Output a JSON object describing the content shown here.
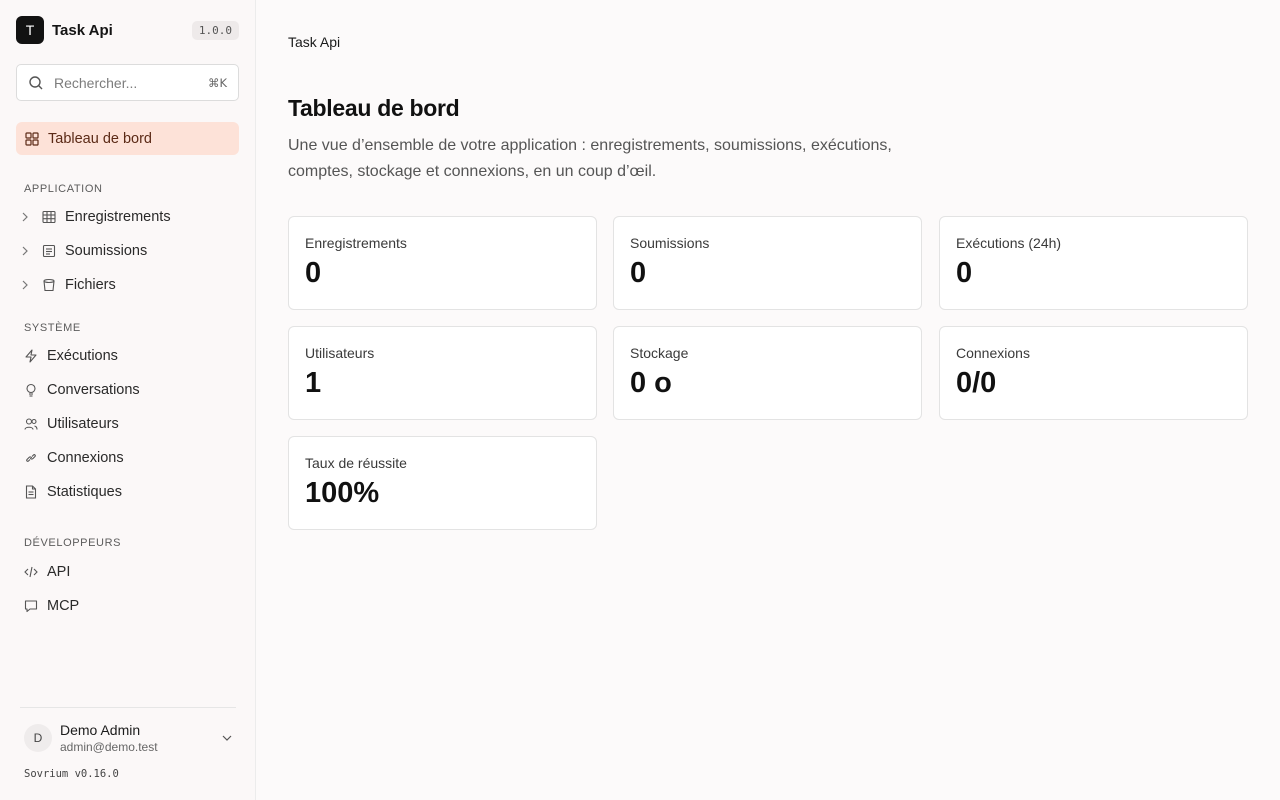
{
  "app": {
    "name": "Task Api",
    "logo_letter": "T",
    "version": "1.0.0"
  },
  "search": {
    "placeholder": "Rechercher...",
    "shortcut": "⌘K"
  },
  "sidebar": {
    "active_item": {
      "label": "Tableau de bord",
      "icon": "dashboard-grid-icon"
    },
    "sections": [
      {
        "title": "APPLICATION",
        "items": [
          {
            "label": "Enregistrements",
            "icon": "table-icon",
            "expandable": true
          },
          {
            "label": "Soumissions",
            "icon": "form-icon",
            "expandable": true
          },
          {
            "label": "Fichiers",
            "icon": "bucket-icon",
            "expandable": true
          }
        ]
      },
      {
        "title": "SYSTÈME",
        "items": [
          {
            "label": "Exécutions",
            "icon": "lightning-icon"
          },
          {
            "label": "Conversations",
            "icon": "bulb-icon"
          },
          {
            "label": "Utilisateurs",
            "icon": "users-icon"
          },
          {
            "label": "Connexions",
            "icon": "link-icon"
          },
          {
            "label": "Statistiques",
            "icon": "document-icon"
          }
        ]
      },
      {
        "title": "DÉVELOPPEURS",
        "items": [
          {
            "label": "API",
            "icon": "code-icon"
          },
          {
            "label": "MCP",
            "icon": "chat-icon"
          }
        ]
      }
    ]
  },
  "user": {
    "initial": "D",
    "name": "Demo Admin",
    "email": "admin@demo.test"
  },
  "footer": {
    "version": "Sovrium v0.16.0"
  },
  "main": {
    "breadcrumb": "Task Api",
    "title": "Tableau de bord",
    "description": "Une vue d’ensemble de votre application : enregistrements, soumissions, exécutions, comptes, stockage et connexions, en un coup d’œil.",
    "cards": [
      {
        "label": "Enregistrements",
        "value": "0"
      },
      {
        "label": "Soumissions",
        "value": "0"
      },
      {
        "label": "Exécutions (24h)",
        "value": "0"
      },
      {
        "label": "Utilisateurs",
        "value": "1"
      },
      {
        "label": "Stockage",
        "value": "0 o"
      },
      {
        "label": "Connexions",
        "value": "0/0"
      },
      {
        "label": "Taux de réussite",
        "value": "100%"
      }
    ]
  },
  "colors": {
    "accent_bg": "#fde2d8",
    "accent_text": "#5b2a16",
    "page_bg": "#fcfafa"
  }
}
